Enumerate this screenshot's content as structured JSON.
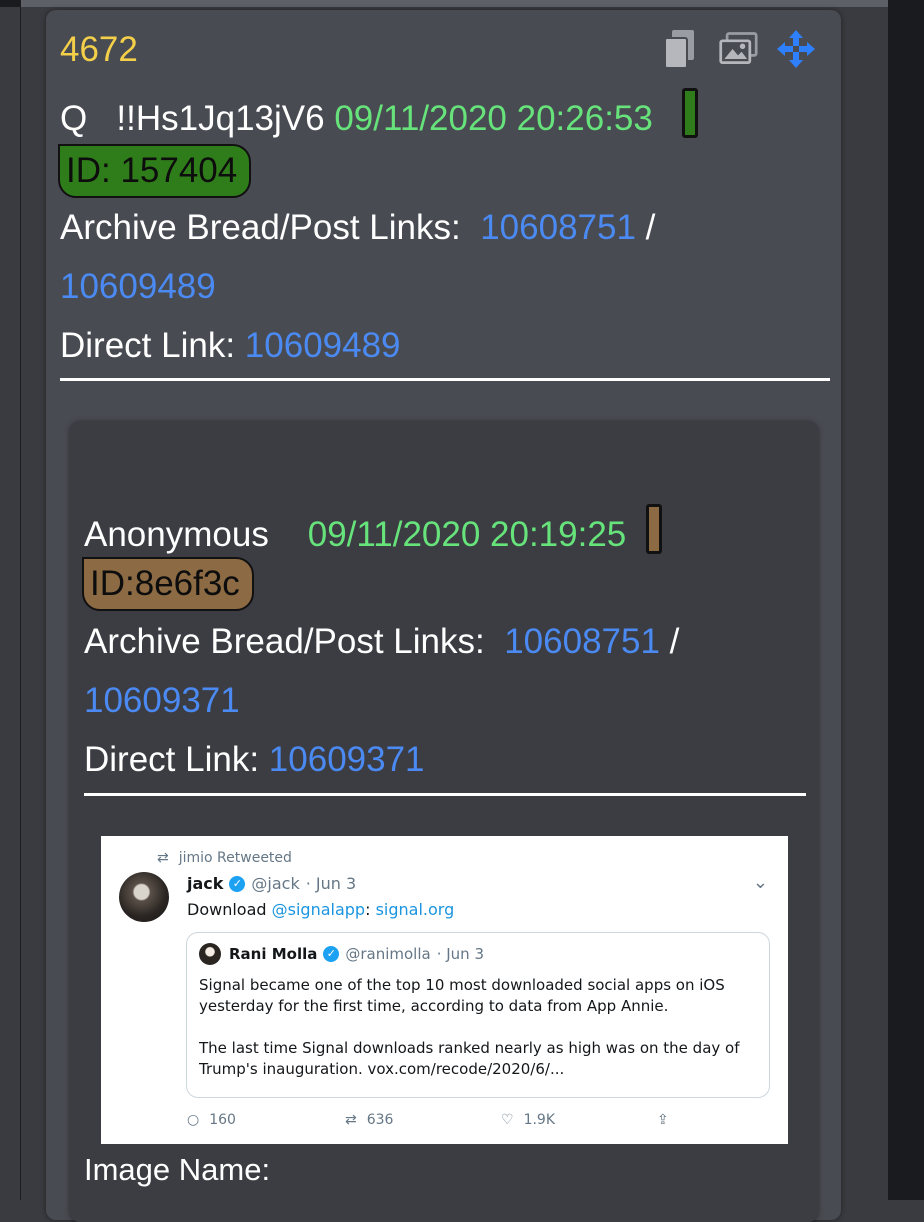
{
  "post": {
    "number": "4672",
    "author": "Q",
    "tripcode": "!!Hs1Jq13jV6",
    "datetime": "09/11/2020 20:26:53",
    "id": "ID: 157404",
    "archive_label": "Archive Bread/Post Links:",
    "archive_bread": "10608751",
    "separator": "/",
    "archive_post": "10609489",
    "direct_label": "Direct Link:",
    "direct_link": "10609489",
    "icons": [
      "copy-icon",
      "images-icon",
      "move-icon"
    ]
  },
  "quoted": {
    "author": "Anonymous",
    "datetime": "09/11/2020 20:19:25",
    "id": "ID:8e6f3c",
    "archive_label": "Archive Bread/Post Links:",
    "archive_bread": "10608751",
    "separator": "/",
    "archive_post": "10609371",
    "direct_label": "Direct Link:",
    "direct_link": "10609371",
    "image_name_label": "Image Name:"
  },
  "tweet": {
    "retweet_label": "jimio Retweeted",
    "name": "jack",
    "handle": "@jack",
    "date": "· Jun 3",
    "text_prefix": "Download ",
    "mention": "@signalapp",
    "colon": ": ",
    "link": "signal.org",
    "quote": {
      "name": "Rani Molla",
      "handle": "@ranimolla",
      "date": "· Jun 3",
      "para1": "Signal became one of the top 10 most downloaded social apps on iOS yesterday for the first time, according to data from App Annie.",
      "para2": "The last time Signal downloads ranked nearly as high was on the day of Trump's inauguration. vox.com/recode/2020/6/..."
    },
    "replies": "160",
    "retweets": "636",
    "likes": "1.9K"
  },
  "colors": {
    "q_id_bg": "#2f7d1a",
    "anon_id_bg": "#8b6a44",
    "timestamp": "#67e37b",
    "link": "#4b8af2",
    "post_number": "#f3cf4a"
  }
}
